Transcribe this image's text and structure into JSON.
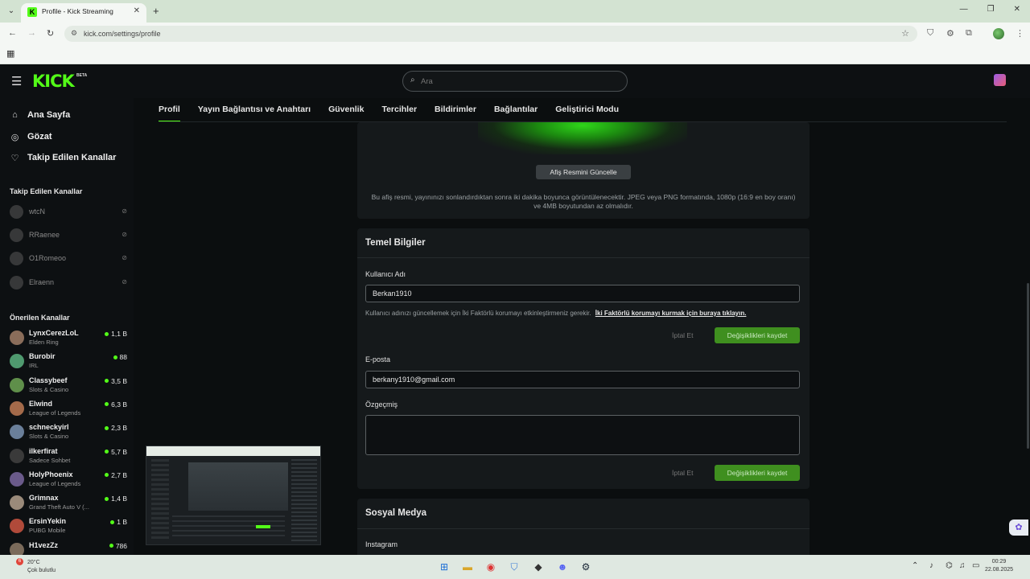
{
  "browser": {
    "tab_title": "Profile - Kick Streaming",
    "tab_favicon": "K",
    "url": "kick.com/settings/profile"
  },
  "header": {
    "logo": "KICK",
    "logo_badge": "BETA",
    "search_placeholder": "Ara"
  },
  "sidebar": {
    "nav": [
      {
        "label": "Ana Sayfa",
        "icon": "home-icon"
      },
      {
        "label": "Gözat",
        "icon": "browse-icon"
      },
      {
        "label": "Takip Edilen Kanallar",
        "icon": "heart-icon"
      }
    ],
    "followed_title": "Takip Edilen Kanallar",
    "followed": [
      "wtcN",
      "RRaenee",
      "O1Romeoo",
      "Elraenn"
    ],
    "recommended_title": "Önerilen Kanallar",
    "recommended": [
      {
        "name": "LynxCerezLoL",
        "category": "Elden Ring",
        "viewers": "1,1 B",
        "color": "#8a6d5a"
      },
      {
        "name": "Burobir",
        "category": "IRL",
        "viewers": "88",
        "color": "#4f9a6f"
      },
      {
        "name": "Classybeef",
        "category": "Slots & Casino",
        "viewers": "3,5 B",
        "color": "#5f8f4a"
      },
      {
        "name": "Elwind",
        "category": "League of Legends",
        "viewers": "6,3 B",
        "color": "#a36a4a"
      },
      {
        "name": "schneckyirl",
        "category": "Slots & Casino",
        "viewers": "2,3 B",
        "color": "#6a7f9a"
      },
      {
        "name": "ilkerfirat",
        "category": "Sadece Sohbet",
        "viewers": "5,7 B",
        "color": "#3a3a3a"
      },
      {
        "name": "HolyPhoenix",
        "category": "League of Legends",
        "viewers": "2,7 B",
        "color": "#6a5a8a"
      },
      {
        "name": "Grimnax",
        "category": "Grand Theft Auto V (...",
        "viewers": "1,4 B",
        "color": "#9a8a7a"
      },
      {
        "name": "ErsinYekin",
        "category": "PUBG Mobile",
        "viewers": "1 B",
        "color": "#b04a3a"
      },
      {
        "name": "H1vezZz",
        "category": "",
        "viewers": "786",
        "color": "#7a6a5a"
      }
    ]
  },
  "tabs": [
    "Profil",
    "Yayın Bağlantısı ve Anahtarı",
    "Güvenlik",
    "Tercihler",
    "Bildirimler",
    "Bağlantılar",
    "Geliştirici Modu"
  ],
  "banner": {
    "update_button": "Afiş Resmini Güncelle",
    "note": "Bu afiş resmi, yayınınızı sonlandırdıktan sonra iki dakika boyunca görüntülenecektir. JPEG veya PNG formatında, 1080p (16:9 en boy oranı) ve 4MB boyutundan az olmalıdır."
  },
  "basic_info": {
    "title": "Temel Bilgiler",
    "username_label": "Kullanıcı Adı",
    "username_value": "Berkan1910",
    "username_hint": "Kullanıcı adınızı güncellemek için İki Faktörlü korumayı etkinleştirmeniz gerekir.",
    "username_hint_link": "İki Faktörlü korumayı kurmak için buraya tıklayın.",
    "cancel_label": "İptal Et",
    "save_label": "Değişiklikleri kaydet",
    "email_label": "E-posta",
    "email_value": "berkany1910@gmail.com",
    "bio_label": "Özgeçmiş",
    "bio_value": "",
    "cancel_label_2": "İptal Et",
    "save_label_2": "Değişiklikleri kaydet"
  },
  "social": {
    "title": "Sosyal Medya",
    "instagram_label": "Instagram"
  },
  "taskbar": {
    "weather_temp": "20°C",
    "weather_desc": "Çok bulutlu",
    "weather_badge": "6",
    "time": "00:29",
    "date": "22.08.2025"
  },
  "colors": {
    "brand": "#53fc18",
    "background": "#0b0e0f",
    "card": "#15191b",
    "save_button": "#3f8f1f"
  }
}
